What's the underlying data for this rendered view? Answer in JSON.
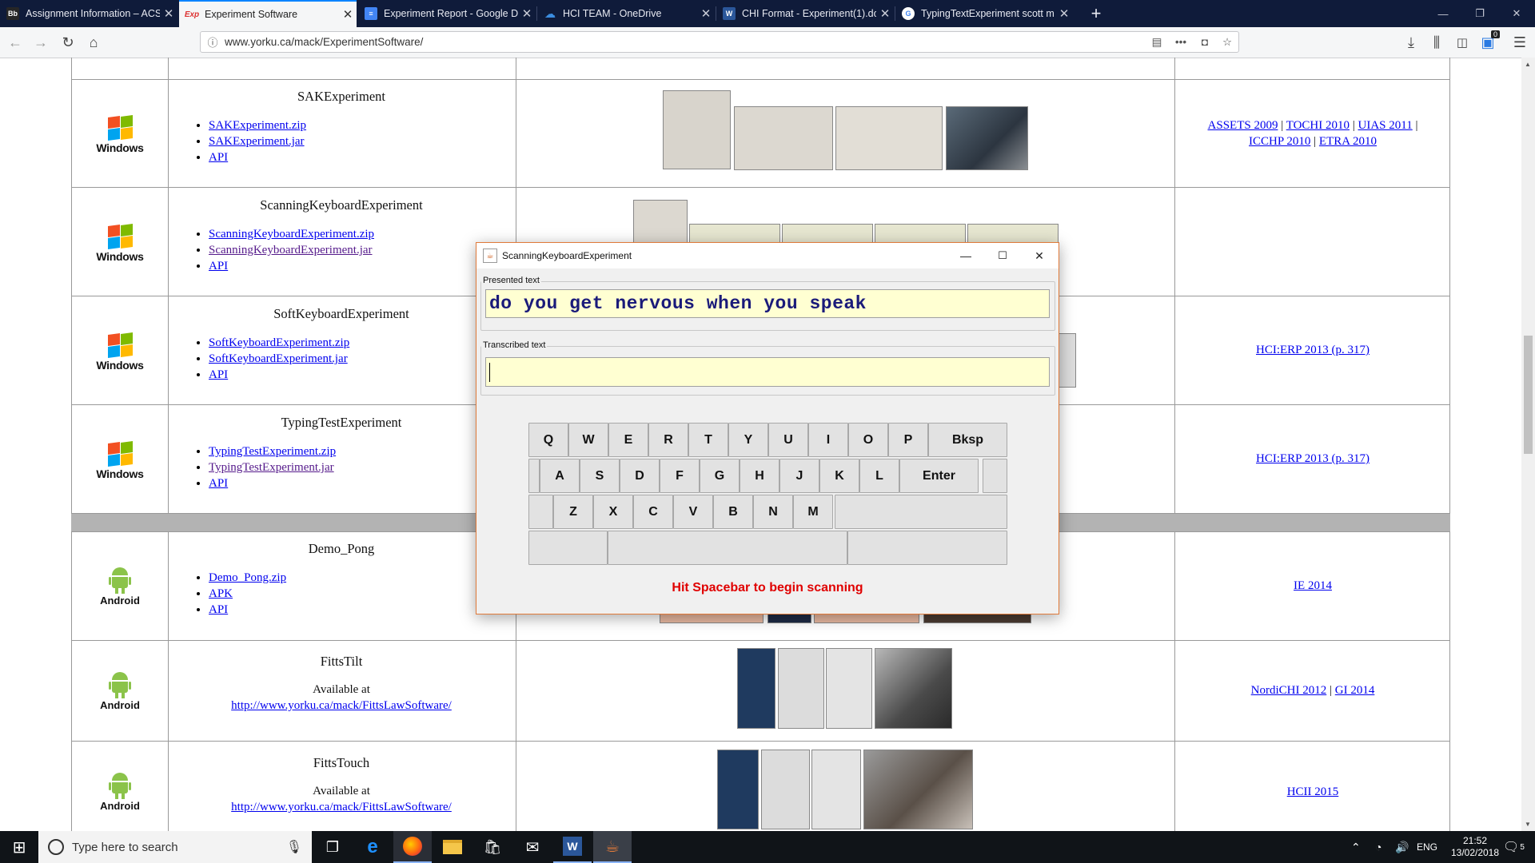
{
  "browser": {
    "tabs": [
      {
        "title": "Assignment Information – ACS",
        "favicon": "Bb"
      },
      {
        "title": "Experiment Software",
        "favicon": "Exp"
      },
      {
        "title": "Experiment Report - Google Do",
        "favicon": "docs-icon"
      },
      {
        "title": "HCI TEAM - OneDrive",
        "favicon": "onedrive-icon"
      },
      {
        "title": "CHI Format - Experiment(1).do",
        "favicon": "W"
      },
      {
        "title": "TypingTextExperiment scott m",
        "favicon": "G"
      }
    ],
    "url": "www.yorku.ca/mack/ExperimentSoftware/",
    "badge_count": "0"
  },
  "rows": [
    {
      "os": "Windows",
      "title": "SAKExperiment",
      "links": [
        "SAKExperiment.zip",
        "SAKExperiment.jar",
        "API"
      ],
      "refs": [
        "ASSETS 2009",
        "TOCHI 2010",
        "UIAS 2011",
        "ICCHP 2010",
        "ETRA 2010"
      ]
    },
    {
      "os": "Windows",
      "title": "ScanningKeyboardExperiment",
      "links": [
        "ScanningKeyboardExperiment.zip",
        "ScanningKeyboardExperiment.jar",
        "API"
      ],
      "refs": []
    },
    {
      "os": "Windows",
      "title": "SoftKeyboardExperiment",
      "links": [
        "SoftKeyboardExperiment.zip",
        "SoftKeyboardExperiment.jar",
        "API"
      ],
      "refs": [
        "HCI:ERP 2013 (p. 317)"
      ]
    },
    {
      "os": "Windows",
      "title": "TypingTestExperiment",
      "links": [
        "TypingTestExperiment.zip",
        "TypingTestExperiment.jar",
        "API"
      ],
      "refs": [
        "HCI:ERP 2013 (p. 317)"
      ]
    },
    {
      "os": "Android",
      "title": "Demo_Pong",
      "links": [
        "Demo_Pong.zip",
        "APK",
        "API"
      ],
      "refs": [
        "IE 2014"
      ]
    },
    {
      "os": "Android",
      "title": "FittsTilt",
      "available": "Available at",
      "url": "http://www.yorku.ca/mack/FittsLawSoftware/",
      "refs": [
        "NordiCHI 2012",
        "GI 2014"
      ]
    },
    {
      "os": "Android",
      "title": "FittsTouch",
      "available": "Available at",
      "url": "http://www.yorku.ca/mack/FittsLawSoftware/",
      "refs": [
        "HCII 2015"
      ]
    }
  ],
  "dialog": {
    "title": "ScanningKeyboardExperiment",
    "presented_label": "Presented text",
    "presented_text": "do you get nervous when you speak",
    "transcribed_label": "Transcribed text",
    "transcribed_text": "",
    "keys_row1": [
      "Q",
      "W",
      "E",
      "R",
      "T",
      "Y",
      "U",
      "I",
      "O",
      "P",
      "Bksp"
    ],
    "keys_row2": [
      "A",
      "S",
      "D",
      "F",
      "G",
      "H",
      "J",
      "K",
      "L",
      "Enter"
    ],
    "keys_row3": [
      "Z",
      "X",
      "C",
      "V",
      "B",
      "N",
      "M"
    ],
    "status": "Hit Spacebar to begin scanning",
    "status_color": "#e00000"
  },
  "taskbar": {
    "search_placeholder": "Type here to search",
    "language": "ENG",
    "time": "21:52",
    "date": "13/02/2018",
    "notification_count": "5"
  }
}
